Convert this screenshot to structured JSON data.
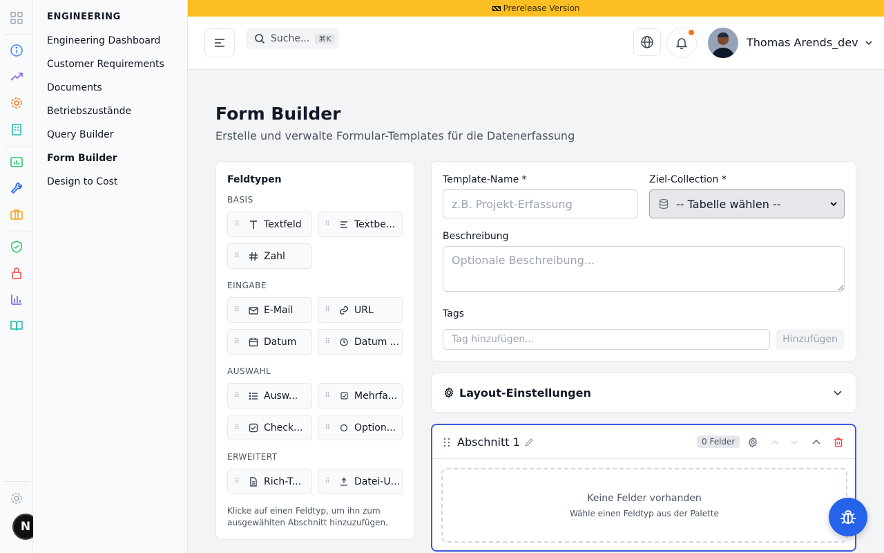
{
  "banner": {
    "icon": "construction-icon",
    "text": "Prerelease Version"
  },
  "nav": {
    "section_title": "ENGINEERING",
    "items": [
      {
        "label": "Engineering Dashboard",
        "active": false
      },
      {
        "label": "Customer Requirements",
        "active": false
      },
      {
        "label": "Documents",
        "active": false
      },
      {
        "label": "Betriebszustände",
        "active": false
      },
      {
        "label": "Query Builder",
        "active": false
      },
      {
        "label": "Form Builder",
        "active": true
      },
      {
        "label": "Design to Cost",
        "active": false
      }
    ]
  },
  "rail": {
    "icons": [
      "apps-grid-icon",
      "info-icon",
      "trending-up-icon",
      "gear-orange-icon",
      "building-icon",
      "chart-folder-icon",
      "wrench-icon",
      "briefcase-icon",
      "shield-check-icon",
      "lock-icon",
      "bar-chart-icon",
      "book-open-icon",
      "settings-icon"
    ],
    "avatar_letter": "N"
  },
  "header": {
    "search_placeholder": "Suche...",
    "search_shortcut": "⌘K",
    "user_name": "Thomas Arends_dev"
  },
  "page": {
    "title": "Form Builder",
    "subtitle": "Erstelle und verwalte Formular-Templates für die Datenerfassung"
  },
  "palette": {
    "title": "Feldtypen",
    "groups": {
      "basis": "BASIS",
      "eingabe": "EINGABE",
      "auswahl": "AUSWAHL",
      "erweitert": "ERWEITERT"
    },
    "fields": {
      "textfeld": "Textfeld",
      "textbereich": "Textbe...",
      "zahl": "Zahl",
      "email": "E-Mail",
      "url": "URL",
      "datum": "Datum",
      "datum_zeit": "Datum ...",
      "auswahl": "Ausw...",
      "mehrfach": "Mehrfa...",
      "checkbox": "Check...",
      "option": "Option...",
      "richtext": "Rich-T...",
      "datei": "Datei-U..."
    },
    "hint": "Klicke auf einen Feldtyp, um ihn zum ausgewählten Abschnitt hinzuzufügen."
  },
  "form": {
    "template_name_label": "Template-Name *",
    "template_name_placeholder": "z.B. Projekt-Erfassung",
    "collection_label": "Ziel-Collection *",
    "collection_selected": "-- Tabelle wählen --",
    "description_label": "Beschreibung",
    "description_placeholder": "Optionale Beschreibung...",
    "tags_label": "Tags",
    "tags_placeholder": "Tag hinzufügen...",
    "add_tag_button": "Hinzufügen"
  },
  "layout_settings": {
    "label": "Layout-Einstellungen"
  },
  "section": {
    "title": "Abschnitt 1",
    "badge": "0 Felder",
    "empty_title": "Keine Felder vorhanden",
    "empty_hint": "Wähle einen Feldtyp aus der Palette"
  },
  "colors": {
    "banner": "#fbbf24",
    "primary": "#2563eb",
    "section_border": "#3b5bdb",
    "danger": "#ef4444",
    "notification_dot": "#f97316"
  }
}
